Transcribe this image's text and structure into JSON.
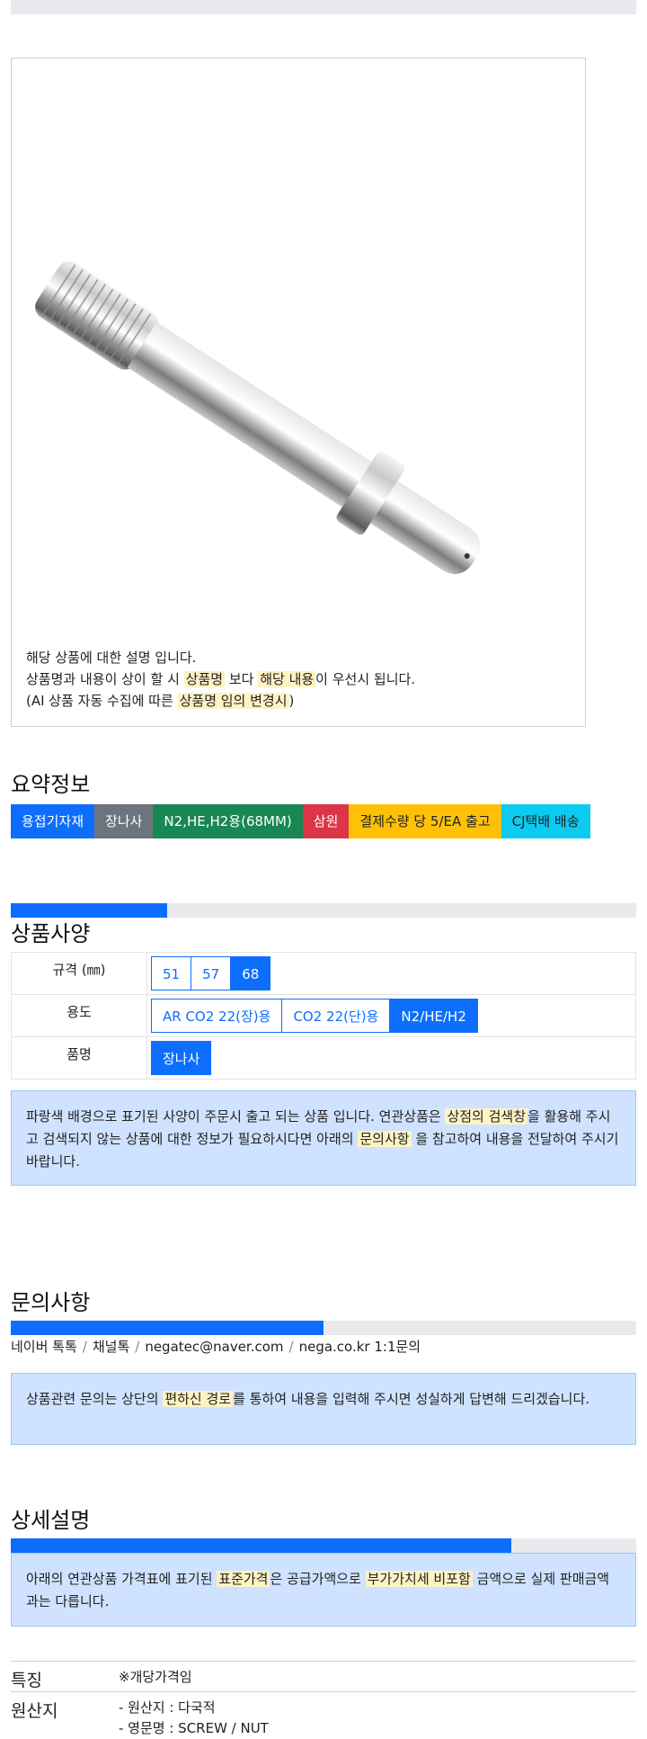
{
  "image_note": {
    "line1": "해당 상품에 대한 설명 입니다.",
    "line2_pre": "상품명과 내용이 상이 할 시 ",
    "line2_hl1": "상품명",
    "line2_mid": " 보다 ",
    "line2_hl2": "해당 내용",
    "line2_post": "이 우선시 됩니다.",
    "line3_pre": "(AI 상품 자동 수집에 따른 ",
    "line3_hl": "상품명 임의 변경시",
    "line3_post": ")"
  },
  "summary": {
    "title": "요약정보",
    "tags": [
      {
        "label": "용접기자재",
        "color": "#0d6efd"
      },
      {
        "label": "장나사",
        "color": "#6c757d"
      },
      {
        "label": "N2,HE,H2용(68MM)",
        "color": "#198754"
      },
      {
        "label": "삼원",
        "color": "#dc3545"
      },
      {
        "label": "결제수량 당 5/EA 출고",
        "color": "#ffc107",
        "text_color": "#222222"
      },
      {
        "label": "CJ택배 배송",
        "color": "#0dcaf0",
        "text_color": "#222222"
      }
    ]
  },
  "spec": {
    "progress": 0.25,
    "title": "상품사양",
    "rows": [
      {
        "label": "규격 (㎜)",
        "options": [
          "51",
          "57",
          "68"
        ],
        "selected": 2
      },
      {
        "label": "용도",
        "options": [
          "AR CO2 22(장)용",
          "CO2 22(단)용",
          "N2/HE/H2"
        ],
        "selected": 2
      },
      {
        "label": "품명",
        "options": [
          "장나사"
        ],
        "selected": 0
      }
    ],
    "info_pre": "파랑색 배경으로 표기된 사양이 주문시 출고 되는 상품 입니다. 연관상품은 ",
    "info_hl1": "상점의 검색창",
    "info_mid": "을 활용해 주시고 검색되지 않는 상품에 대한 정보가 필요하시다면 아래의 ",
    "info_hl2": "문의사항",
    "info_post": " 을 참고하여 내용을 전달하여 주시기 바랍니다."
  },
  "inquiry": {
    "title": "문의사항",
    "progress": 0.5,
    "contacts": [
      "네이버 톡톡",
      "채널톡",
      "negatec@naver.com",
      "nega.co.kr 1:1문의"
    ],
    "separator": "/",
    "info_pre": "상품관련 문의는 상단의 ",
    "info_hl": "편하신 경로",
    "info_post": "를 통하여 내용을 입력해 주시면 성실하게 답변해 드리겠습니다."
  },
  "detail": {
    "title": "상세설명",
    "progress": 0.8,
    "info_pre": "아래의 연관상품 가격표에 표기된 ",
    "info_hl1": "표준가격",
    "info_mid": "은 공급가액으로 ",
    "info_hl2": "부가가치세 비포함",
    "info_post": " 금액으로 실제 판매금액과는 다릅니다.",
    "features": [
      {
        "key": "특징",
        "values": [
          "※개당가격임"
        ]
      },
      {
        "key": "원산지",
        "values": [
          "- 원산지 : 다국적",
          "- 영문명 : SCREW / NUT"
        ]
      }
    ]
  }
}
